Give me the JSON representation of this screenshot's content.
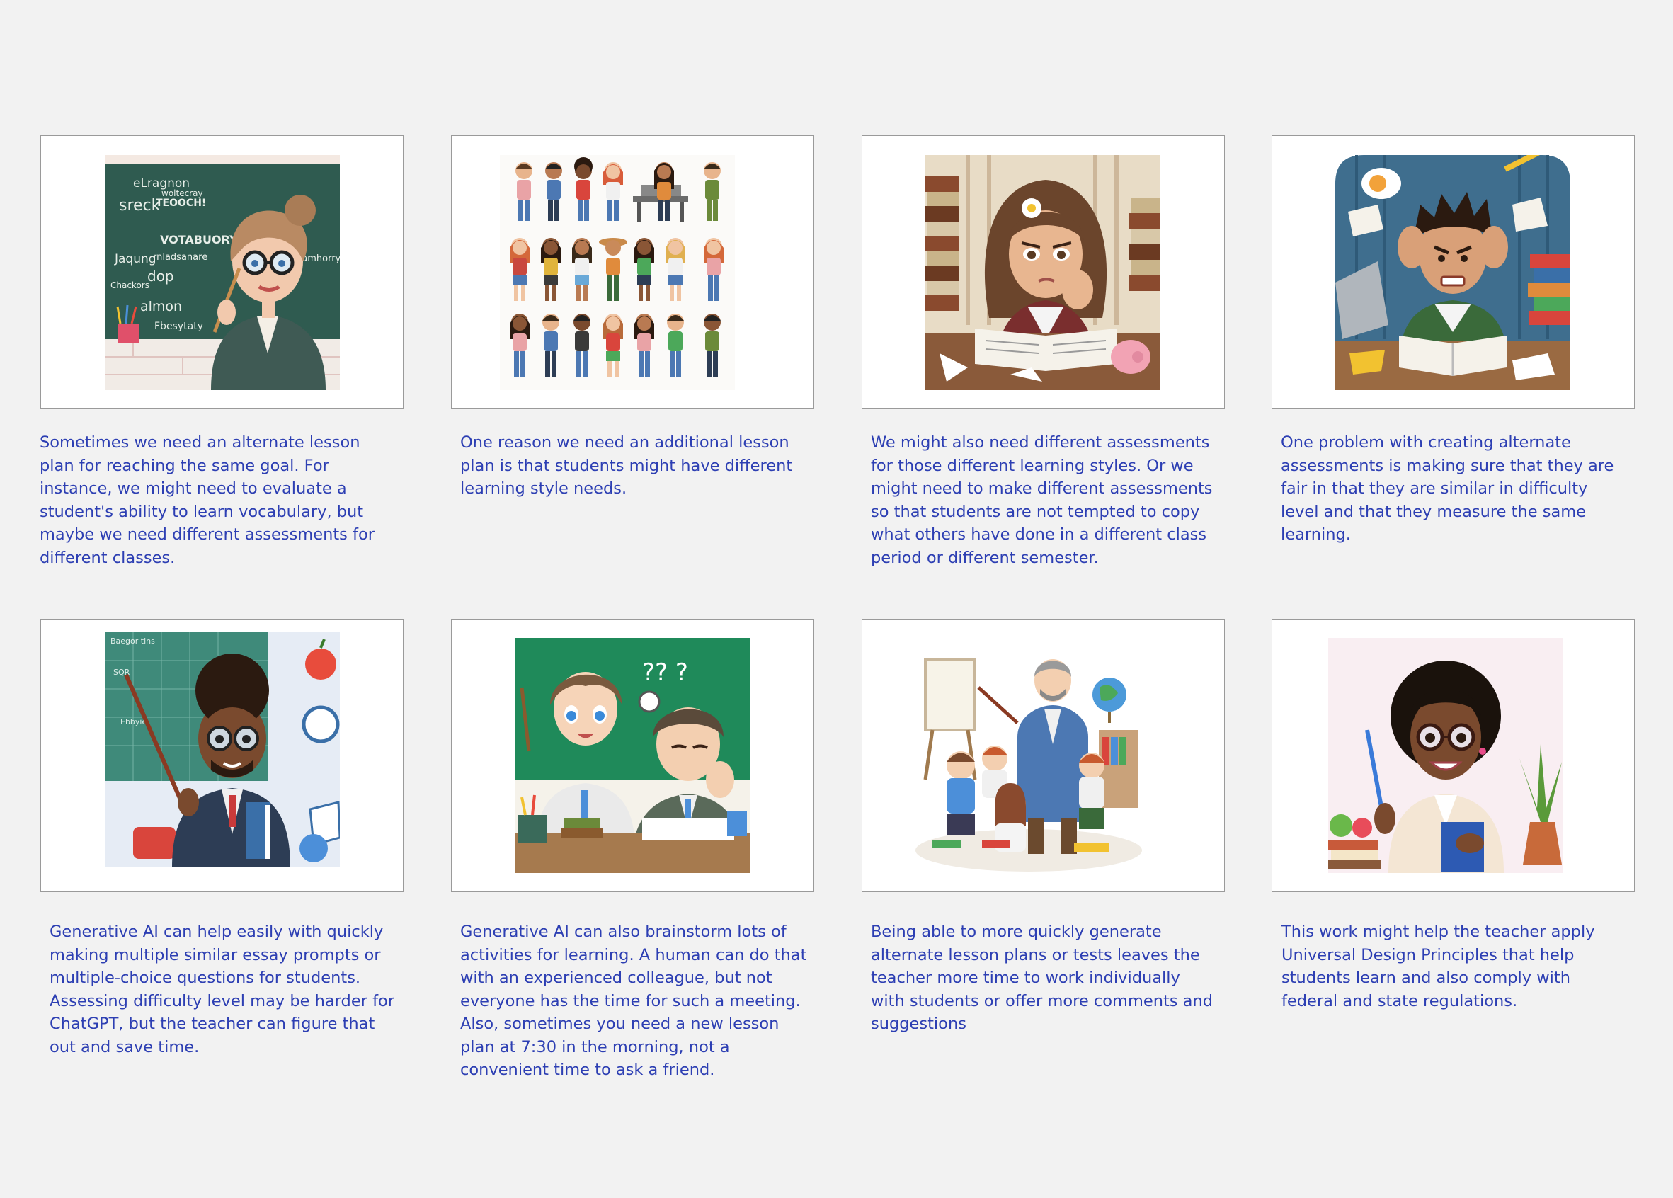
{
  "cards": [
    {
      "caption": "Sometimes we need an alternate lesson plan for reaching the same goal. For instance, we might need to evaluate a student's ability to learn vocabulary, but maybe we need different assessments for different classes.",
      "image": "teacher-at-vocabulary-chalkboard-illustration",
      "board_words": [
        "eLragnon",
        "sreck",
        "TEOOCH!",
        "woltecray",
        "VOTABUORY",
        "rnladsanare",
        "dop",
        "Chackors",
        "almon",
        "Fbesytaty",
        "Samhorry",
        "Jaqung"
      ]
    },
    {
      "caption": "One reason we need an additional lesson plan is that students might have different learning style needs.",
      "image": "grid-of-diverse-students-illustration"
    },
    {
      "caption": "We might also need different assessments for those different learning styles. Or we might need to make different assessments so that students are not tempted to copy what others have done in a different class period or different semester.",
      "image": "frustrated-student-at-desk-with-books-illustration"
    },
    {
      "caption": "One problem with creating alternate assessments is making sure that they are fair in that they are similar in difficulty level and that they measure the same learning.",
      "image": "stressed-student-with-papers-illustration"
    },
    {
      "caption": "Generative AI can help easily with quickly making multiple similar essay prompts or multiple-choice questions for students. Assessing difficulty level may be harder for ChatGPT, but the teacher can figure that out and save time.",
      "image": "teacher-with-pointer-and-books-illustration",
      "board_words": [
        "Baegor tins",
        "SQR",
        "Ebbyie"
      ]
    },
    {
      "caption": "Generative AI can also brainstorm lots of activities for learning. A human can do that with an experienced colleague, but not everyone has the time for such a meeting. Also, sometimes you need a new lesson plan at 7:30 in the morning, not a convenient time to ask a friend.",
      "image": "two-teachers-at-desk-one-tired-illustration",
      "marks": "?? ?"
    },
    {
      "caption": "Being able to more quickly generate alternate lesson plans or tests leaves the teacher more time to work individually with students or offer more comments and suggestions",
      "image": "teacher-with-group-of-children-illustration"
    },
    {
      "caption": "This work might help the teacher apply Universal Design Principles that help students learn and also comply with federal and state regulations.",
      "image": "smiling-teacher-holding-pencil-illustration"
    }
  ],
  "colors": {
    "background": "#f2f2f2",
    "card": "#ffffff",
    "card_border": "#9a9a9a",
    "caption_text": "#2d3fb3"
  }
}
